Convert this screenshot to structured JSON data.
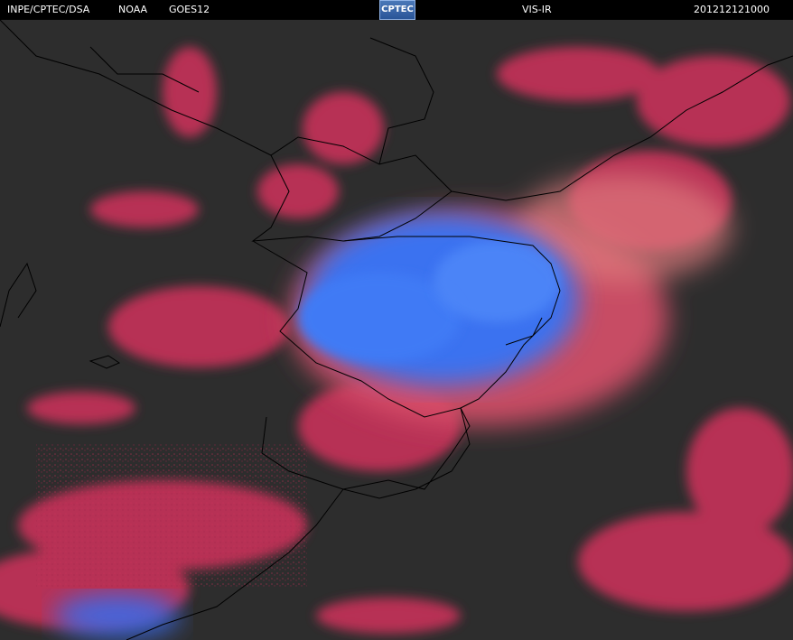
{
  "header": {
    "source": "INPE/CPTEC/DSA",
    "agency": "NOAA",
    "satellite": "GOES12",
    "logo": "CPTEC",
    "channel": "VIS-IR",
    "timestamp": "201212121000"
  },
  "colors": {
    "background": "#2b2b2b",
    "header_bg": "#000000",
    "cloud_red": "#d8345e",
    "cloud_blue": "#3a72f0",
    "coastline": "#000000"
  },
  "map": {
    "type": "satellite-composite",
    "imagery": "GOES12 VIS-IR enhanced",
    "features": [
      "coastline",
      "country-borders",
      "state-borders",
      "cloud-cover"
    ]
  }
}
